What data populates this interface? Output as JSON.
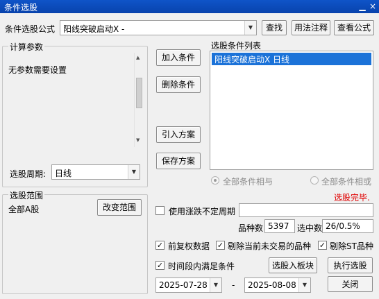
{
  "window": {
    "title": "条件选股",
    "close_glyph": "×"
  },
  "formula": {
    "label": "条件选股公式",
    "value": "阳线突破启动X -",
    "find_button": "查找",
    "usage_button": "用法注释",
    "view_button": "查看公式"
  },
  "params": {
    "group_title": "计算参数",
    "message": "无参数需要设置"
  },
  "period": {
    "label": "选股周期:",
    "value": "日线"
  },
  "actions": {
    "add": "加入条件",
    "delete": "删除条件",
    "import": "引入方案",
    "save": "保存方案"
  },
  "conditions": {
    "title": "选股条件列表",
    "items": [
      "阳线突破启动X  日线"
    ]
  },
  "logic": {
    "and_label": "全部条件相与",
    "or_label": "全部条件相或"
  },
  "status": {
    "text": "选股完毕.",
    "color": "#e00000"
  },
  "range": {
    "group_title": "选股范围",
    "value": "全部A股",
    "change_button": "改变范围"
  },
  "options": {
    "variable_period": {
      "label": "使用涨跌不定周期",
      "checked": false
    },
    "adjust": {
      "label": "前复权数据",
      "checked": true
    },
    "exclude_untraded": {
      "label": "剔除当前未交易的品种",
      "checked": true
    },
    "exclude_st": {
      "label": "剔除ST品种",
      "checked": true
    },
    "time_range": {
      "label": "时间段内满足条件",
      "checked": true
    },
    "check_mark": "✓"
  },
  "stats": {
    "count_label": "品种数",
    "count_value": "5397",
    "selected_label": "选中数",
    "selected_value": "26/0.5%"
  },
  "dates": {
    "start": "2025-07-28",
    "separator": "-",
    "end": "2025-08-08"
  },
  "buttons": {
    "to_block": "选股入板块",
    "execute": "执行选股",
    "close": "关闭"
  }
}
